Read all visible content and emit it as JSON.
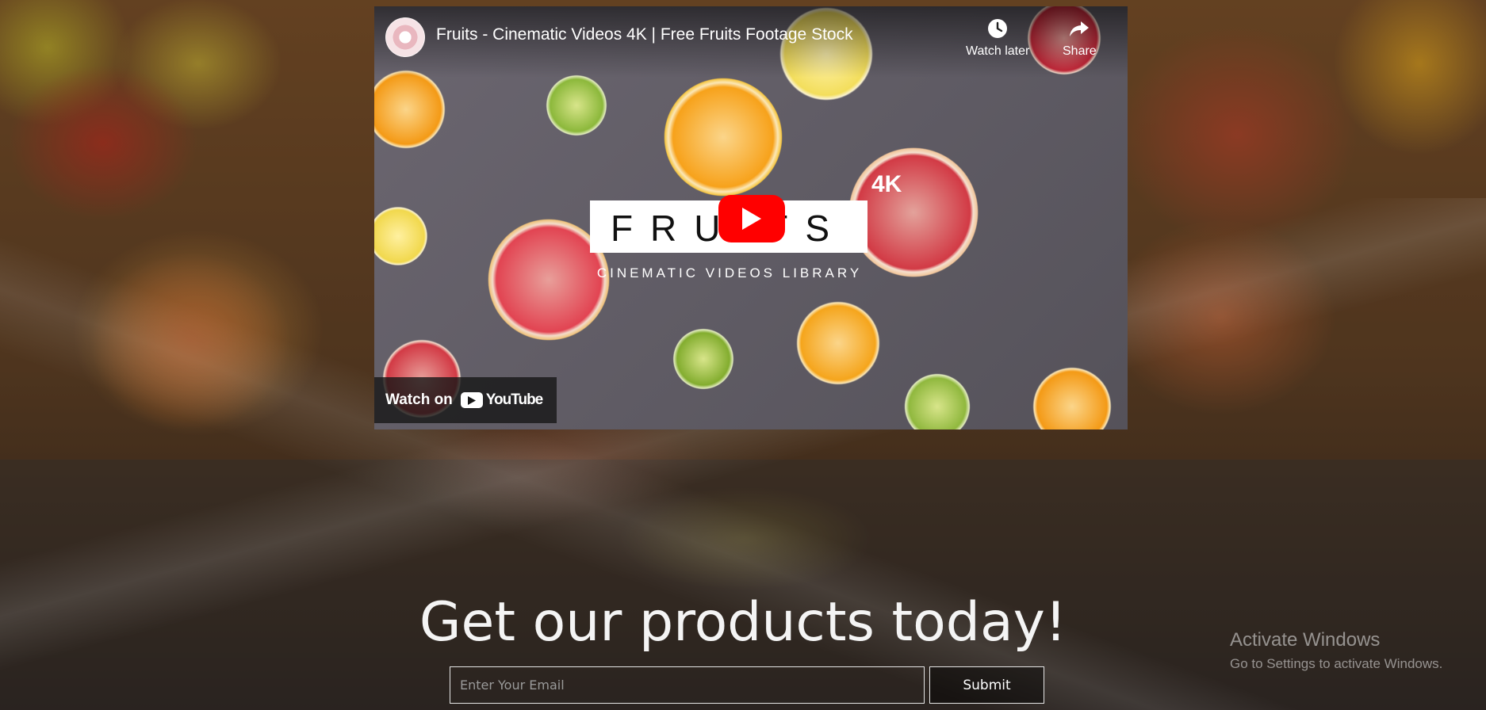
{
  "video": {
    "title": "Fruits - Cinematic Videos 4K | Free Fruits Footage Stock",
    "watch_later_label": "Watch later",
    "share_label": "Share",
    "thumbnail_word": "FRUITS",
    "thumbnail_badge": "4K",
    "thumbnail_subtitle": "CINEMATIC VIDEOS LIBRARY",
    "watch_on_label": "Watch on",
    "youtube_label": "YouTube",
    "icons": {
      "channel": "channel-avatar",
      "watch_later": "clock-icon",
      "share": "share-arrow-icon",
      "play": "play-icon"
    },
    "colors": {
      "play_button": "#ff0000"
    }
  },
  "cta": {
    "heading": "Get our products today!",
    "email_placeholder": "Enter Your Email",
    "email_value": "",
    "submit_label": "Submit"
  },
  "windows_watermark": {
    "title": "Activate Windows",
    "subtitle": "Go to Settings to activate Windows."
  }
}
